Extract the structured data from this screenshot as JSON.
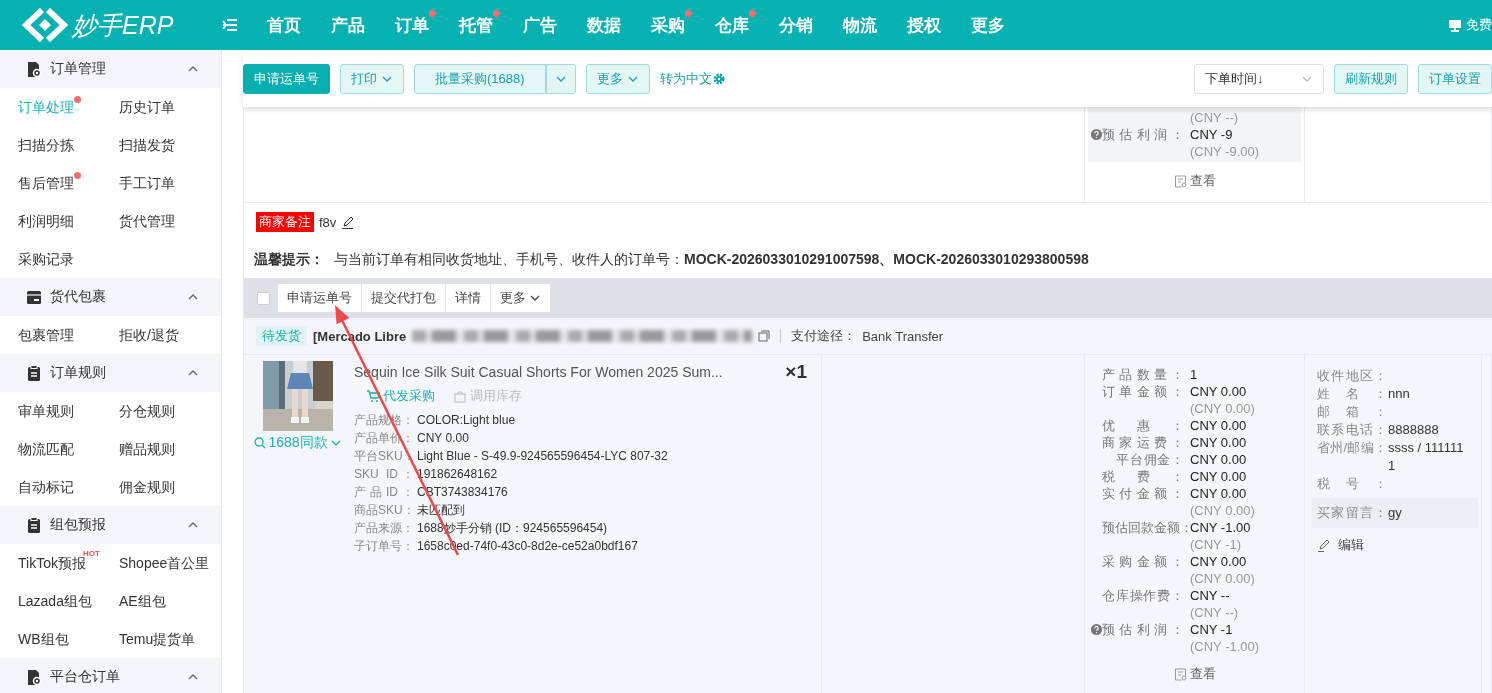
{
  "topbar": {
    "logo": "妙手ERP",
    "nav": [
      {
        "label": "首页",
        "badge": false
      },
      {
        "label": "产品",
        "badge": false
      },
      {
        "label": "订单",
        "badge": true
      },
      {
        "label": "托管",
        "badge": true
      },
      {
        "label": "广告",
        "badge": false
      },
      {
        "label": "数据",
        "badge": false
      },
      {
        "label": "采购",
        "badge": true
      },
      {
        "label": "仓库",
        "badge": true
      },
      {
        "label": "分销",
        "badge": false
      },
      {
        "label": "物流",
        "badge": false
      },
      {
        "label": "授权",
        "badge": false
      },
      {
        "label": "更多",
        "badge": false
      }
    ],
    "right_link": "免费"
  },
  "sidebar": {
    "sections": [
      {
        "title": "订单管理",
        "expanded": true,
        "items": [
          {
            "label": "订单处理",
            "selected": true,
            "dot": true
          },
          {
            "label": "历史订单",
            "selected": false,
            "dot": false
          },
          {
            "label": "扫描分拣",
            "selected": false,
            "dot": false
          },
          {
            "label": "扫描发货",
            "selected": false,
            "dot": false
          },
          {
            "label": "售后管理",
            "selected": false,
            "dot": true
          },
          {
            "label": "手工订单",
            "selected": false,
            "dot": false
          },
          {
            "label": "利润明细",
            "selected": false,
            "dot": false
          },
          {
            "label": "货代管理",
            "selected": false,
            "dot": false
          },
          {
            "label": "采购记录",
            "selected": false,
            "dot": false
          }
        ]
      },
      {
        "title": "货代包裹",
        "expanded": true,
        "items": [
          {
            "label": "包裹管理",
            "selected": false,
            "dot": false
          },
          {
            "label": "拒收/退货",
            "selected": false,
            "dot": false
          }
        ]
      },
      {
        "title": "订单规则",
        "expanded": true,
        "items": [
          {
            "label": "审单规则",
            "selected": false,
            "dot": false
          },
          {
            "label": "分仓规则",
            "selected": false,
            "dot": false
          },
          {
            "label": "物流匹配",
            "selected": false,
            "dot": false
          },
          {
            "label": "赠品规则",
            "selected": false,
            "dot": false
          },
          {
            "label": "自动标记",
            "selected": false,
            "dot": false
          },
          {
            "label": "佣金规则",
            "selected": false,
            "dot": false
          }
        ]
      },
      {
        "title": "组包预报",
        "expanded": true,
        "items": [
          {
            "label": "TikTok预报",
            "selected": false,
            "dot": false,
            "tag": "HOT"
          },
          {
            "label": "Shopee首公里",
            "selected": false,
            "dot": false
          },
          {
            "label": "Lazada组包",
            "selected": false,
            "dot": false
          },
          {
            "label": "AE组包",
            "selected": false,
            "dot": false
          },
          {
            "label": "WB组包",
            "selected": false,
            "dot": false
          },
          {
            "label": "Temu提货单",
            "selected": false,
            "dot": false
          }
        ]
      },
      {
        "title": "平台仓订单",
        "expanded": true
      }
    ]
  },
  "toolbar": {
    "buttons": [
      {
        "label": "申请运单号",
        "kind": "primary"
      },
      {
        "label": "打印",
        "kind": "dropdown"
      },
      {
        "label": "批量采购(1688)",
        "kind": "split"
      },
      {
        "label": "更多",
        "kind": "dropdown"
      }
    ],
    "link": "转为中文",
    "sort": {
      "value": "下单时间↓"
    },
    "right_buttons": [
      "刷新规则",
      "订单设置"
    ]
  },
  "previous_order": {
    "finance": [
      {
        "sub": "(CNY --)"
      },
      {
        "label": "预估利润：",
        "value": "CNY -9",
        "sub": "(CNY -9.00)",
        "help": true,
        "indented": false
      }
    ],
    "view_link": "查看"
  },
  "order": {
    "remark_tag": "商家备注",
    "remark": "f8v",
    "hint_label": "温馨提示：",
    "hint": "与当前订单有相同收货地址、手机号、收件人的订单号：**MOCK-2026033010291007598、MOCK-2026033010293800598**",
    "checkbox": {
      "checked": false
    },
    "actions": [
      {
        "label": "申请运单号",
        "caret": false
      },
      {
        "label": "提交代打包",
        "caret": false
      },
      {
        "label": "详情",
        "caret": false
      },
      {
        "label": "更多",
        "caret": true
      }
    ],
    "status": "待发货",
    "store": "[Mercado Libre",
    "payment_label": "支付途径：",
    "payment": "Bank Transfer",
    "product": {
      "same_style": "1688同款",
      "title": "Sequin Ice Silk Suit Casual Shorts For Women 2025 Sum...",
      "quantity": "×1",
      "actions": [
        {
          "label": "代发采购",
          "disabled": false
        },
        {
          "label": "调用库存",
          "disabled": true
        }
      ],
      "details": [
        {
          "label": "产品规格：",
          "value": "COLOR:Light blue"
        },
        {
          "label": "产品单价：",
          "value": "CNY 0.00"
        },
        {
          "label": "平台SKU：",
          "value": "Light Blue - S-49.9-924565596454-LYC 807-32"
        },
        {
          "label": "SKU ID：",
          "value": "191862648162"
        },
        {
          "label": "产品ID：",
          "value": "CBT3743834176"
        },
        {
          "label": "商品SKU：",
          "value": "未匹配到"
        },
        {
          "label": "产品来源：",
          "value": "1688妙手分销 (ID：924565596454)"
        },
        {
          "label": "子订单号：",
          "value": "1658c0ed-74f0-43c0-8d2e-ce52a0bdf167"
        }
      ]
    },
    "finance": [
      {
        "label": "产品数量：",
        "value": "1",
        "help": false,
        "indented": false
      },
      {
        "label": "订单金额：",
        "value": "CNY 0.00",
        "sub": "(CNY 0.00)",
        "help": false,
        "indented": false
      },
      {
        "label": "优惠：",
        "value": "CNY 0.00",
        "help": false,
        "indented": false
      },
      {
        "label": "商家运费：",
        "value": "CNY 0.00",
        "help": false,
        "indented": false
      },
      {
        "label": "平台佣金：",
        "value": "CNY 0.00",
        "help": false,
        "indented": true
      },
      {
        "label": "税费：",
        "value": "CNY 0.00",
        "help": false,
        "indented": false
      },
      {
        "label": "实付金额：",
        "value": "CNY 0.00",
        "sub": "(CNY 0.00)",
        "help": false,
        "indented": false
      },
      {
        "label": "预估回款金额：",
        "value": "CNY -1.00",
        "sub": "(CNY -1)",
        "help": false,
        "indented": false
      },
      {
        "label": "采购金额：",
        "value": "CNY 0.00",
        "sub": "(CNY 0.00)",
        "help": false,
        "indented": false
      },
      {
        "label": "仓库操作费：",
        "value": "CNY --",
        "sub": "(CNY --)",
        "help": false,
        "indented": false
      },
      {
        "label": "预估利润：",
        "value": "CNY -1",
        "sub": "(CNY -1.00)",
        "help": true,
        "indented": false
      }
    ],
    "view_link": "查看",
    "buyer": [
      {
        "label": "收件地区："
      },
      {
        "label": "姓名：",
        "value": "nnn"
      },
      {
        "label": "邮箱："
      },
      {
        "label": "联系电话：",
        "value": "8888888"
      },
      {
        "label": "省州/邮编：",
        "value": "ssss / 1111111"
      },
      {
        "label": "税号："
      }
    ],
    "buyer_message": {
      "label": "买家留言：",
      "value": "gy"
    },
    "edit_link": "编辑"
  }
}
